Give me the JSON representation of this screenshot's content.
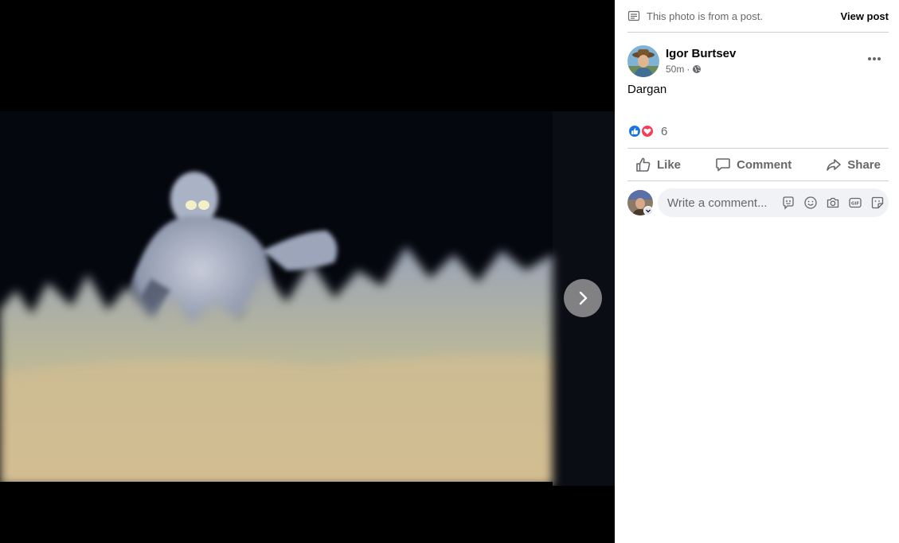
{
  "notice": {
    "text": "This photo is from a post.",
    "link_label": "View post"
  },
  "post": {
    "author": "Igor Burtsev",
    "time": "50m",
    "separator": "·",
    "audience_icon": "globe-icon",
    "caption": "Dargan"
  },
  "reactions": {
    "types": [
      "like",
      "love"
    ],
    "count": "6"
  },
  "actions": {
    "like": "Like",
    "comment": "Comment",
    "share": "Share"
  },
  "comment_box": {
    "placeholder": "Write a comment...",
    "icons": [
      "avatar-sticker-icon",
      "emoji-icon",
      "camera-icon",
      "gif-icon",
      "sticker-icon"
    ]
  },
  "viewer": {
    "next_icon": "chevron-right-icon"
  },
  "colors": {
    "accent_blue": "#1b74e4",
    "love_red": "#f33e58",
    "secondary_text": "#65676b"
  }
}
